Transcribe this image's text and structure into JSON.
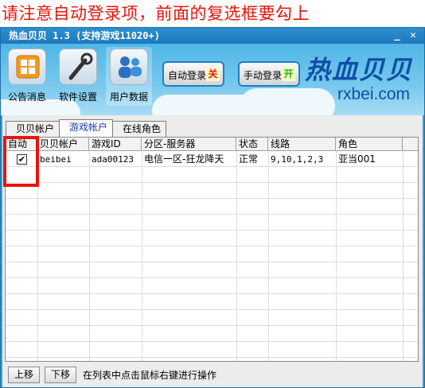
{
  "annotation": "请注意自动登录项，前面的复选框要勾上",
  "window": {
    "title": "热血贝贝 1.3  (支持游戏11020+)",
    "minimize": "_",
    "close": "✕"
  },
  "toolbar": {
    "items": [
      {
        "label": "公告消息",
        "icon": "announcement-icon"
      },
      {
        "label": "软件设置",
        "icon": "wrench-icon"
      },
      {
        "label": "用户数据",
        "icon": "users-icon"
      }
    ],
    "auto_login": {
      "label": "自动登录",
      "state": "关",
      "state_color": "#e8140c"
    },
    "manual_login": {
      "label": "手动登录",
      "state": "开",
      "state_color": "#2aa82a"
    },
    "brand_cn": "热血贝贝",
    "brand_en": "rxbei.com"
  },
  "tabs": [
    {
      "label": "贝贝帐户",
      "active": false
    },
    {
      "label": "游戏帐户",
      "active": true
    },
    {
      "label": "在线角色",
      "active": false
    }
  ],
  "table": {
    "columns": [
      "自动",
      "贝贝帐户",
      "游戏ID",
      "分区-服务器",
      "状态",
      "线路",
      "角色"
    ],
    "rows": [
      {
        "auto": true,
        "account": "beibei",
        "game_id": "ada00123",
        "server": "电信一区-狂龙降天",
        "status": "正常",
        "lines": "9,10,1,2,3",
        "role": "亚当001"
      }
    ]
  },
  "footer": {
    "move_up": "上移",
    "move_down": "下移",
    "hint": "在列表中点击鼠标右键进行操作"
  },
  "colors": {
    "highlight": "#e8140c",
    "annotation": "#e8140c",
    "accent": "#3aa0d8"
  }
}
